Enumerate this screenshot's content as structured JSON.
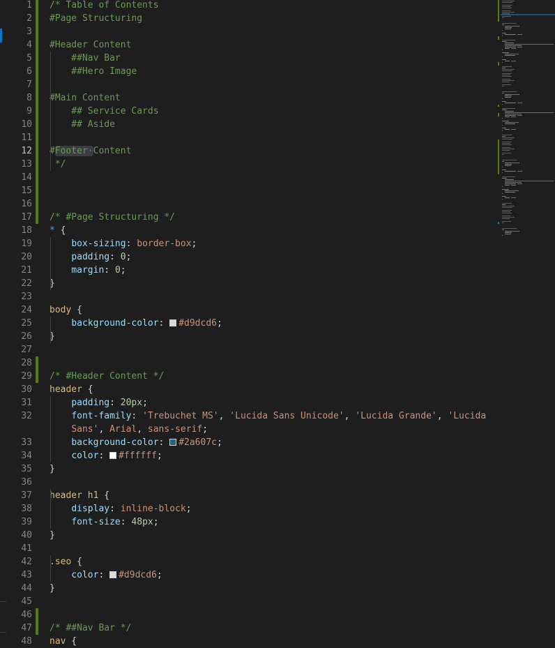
{
  "editor": {
    "active_line": 12,
    "lines": [
      {
        "n": "1",
        "tokens": [
          [
            "c-comment",
            "/* Table of Contents"
          ]
        ],
        "diff": true
      },
      {
        "n": "2",
        "tokens": [
          [
            "c-comment",
            "#Page Structuring"
          ]
        ],
        "diff": true
      },
      {
        "n": "3",
        "tokens": [],
        "diff": true
      },
      {
        "n": "4",
        "tokens": [
          [
            "c-comment",
            "#Header Content"
          ]
        ],
        "diff": true
      },
      {
        "n": "5",
        "tokens": [
          [
            "c-comment",
            "    ##Nav Bar"
          ]
        ],
        "diff": true
      },
      {
        "n": "6",
        "tokens": [
          [
            "c-comment",
            "    ##Hero Image"
          ]
        ],
        "diff": true
      },
      {
        "n": "7",
        "tokens": [],
        "diff": true
      },
      {
        "n": "8",
        "tokens": [
          [
            "c-comment",
            "#Main Content"
          ]
        ],
        "diff": true
      },
      {
        "n": "9",
        "tokens": [
          [
            "c-comment",
            "    ## Service Cards"
          ]
        ],
        "diff": true
      },
      {
        "n": "10",
        "tokens": [
          [
            "c-comment",
            "    ## Aside"
          ]
        ],
        "diff": true
      },
      {
        "n": "11",
        "tokens": [],
        "diff": true
      },
      {
        "n": "12",
        "tokens": [
          [
            "c-comment",
            "#"
          ],
          [
            "c-comment wordhl",
            "Footer·"
          ],
          [
            "c-comment",
            "Content"
          ]
        ],
        "diff": true
      },
      {
        "n": "13",
        "tokens": [
          [
            "c-comment",
            " */"
          ]
        ],
        "diff": true
      },
      {
        "n": "14",
        "tokens": [],
        "diff": true
      },
      {
        "n": "15",
        "tokens": [],
        "diff": true
      },
      {
        "n": "16",
        "tokens": [],
        "diff": true
      },
      {
        "n": "17",
        "tokens": [
          [
            "c-comment",
            "/* #Page Structuring */"
          ]
        ],
        "diff": true
      },
      {
        "n": "18",
        "tokens": [
          [
            "c-star",
            "*"
          ],
          [
            "c-punc",
            " {"
          ]
        ]
      },
      {
        "n": "19",
        "tokens": [
          [
            "c-punc",
            "    "
          ],
          [
            "c-prop",
            "box-sizing"
          ],
          [
            "c-punc",
            ": "
          ],
          [
            "c-val",
            "border-box"
          ],
          [
            "c-punc",
            ";"
          ]
        ]
      },
      {
        "n": "20",
        "tokens": [
          [
            "c-punc",
            "    "
          ],
          [
            "c-prop",
            "padding"
          ],
          [
            "c-punc",
            ": "
          ],
          [
            "c-num",
            "0"
          ],
          [
            "c-punc",
            ";"
          ]
        ]
      },
      {
        "n": "21",
        "tokens": [
          [
            "c-punc",
            "    "
          ],
          [
            "c-prop",
            "margin"
          ],
          [
            "c-punc",
            ": "
          ],
          [
            "c-num",
            "0"
          ],
          [
            "c-punc",
            ";"
          ]
        ]
      },
      {
        "n": "22",
        "tokens": [
          [
            "c-punc",
            "}"
          ]
        ]
      },
      {
        "n": "23",
        "tokens": []
      },
      {
        "n": "24",
        "tokens": [
          [
            "c-sel",
            "body"
          ],
          [
            "c-punc",
            " {"
          ]
        ]
      },
      {
        "n": "25",
        "tokens": [
          [
            "c-punc",
            "    "
          ],
          [
            "c-prop",
            "background-color"
          ],
          [
            "c-punc",
            ": "
          ],
          [
            "swatch",
            "#d9dcd6"
          ],
          [
            "c-val",
            "#d9dcd6"
          ],
          [
            "c-punc",
            ";"
          ]
        ]
      },
      {
        "n": "26",
        "tokens": [
          [
            "c-punc",
            "}"
          ]
        ]
      },
      {
        "n": "27",
        "tokens": []
      },
      {
        "n": "28",
        "tokens": [],
        "diff": true
      },
      {
        "n": "29",
        "tokens": [
          [
            "c-comment",
            "/* #Header Content */"
          ]
        ],
        "diff": true
      },
      {
        "n": "30",
        "tokens": [
          [
            "c-sel",
            "header"
          ],
          [
            "c-punc",
            " {"
          ]
        ]
      },
      {
        "n": "31",
        "tokens": [
          [
            "c-punc",
            "    "
          ],
          [
            "c-prop",
            "padding"
          ],
          [
            "c-punc",
            ": "
          ],
          [
            "c-num",
            "20px"
          ],
          [
            "c-punc",
            ";"
          ]
        ]
      },
      {
        "n": "32",
        "tokens": [
          [
            "c-punc",
            "    "
          ],
          [
            "c-prop",
            "font-family"
          ],
          [
            "c-punc",
            ": "
          ],
          [
            "c-val",
            "'Trebuchet MS'"
          ],
          [
            "c-punc",
            ", "
          ],
          [
            "c-val",
            "'Lucida Sans Unicode'"
          ],
          [
            "c-punc",
            ", "
          ],
          [
            "c-val",
            "'Lucida Grande'"
          ],
          [
            "c-punc",
            ", "
          ],
          [
            "c-val",
            "'Lucida"
          ]
        ]
      },
      {
        "n": "",
        "tokens": [
          [
            "c-punc",
            "    "
          ],
          [
            "c-val",
            "Sans'"
          ],
          [
            "c-punc",
            ", "
          ],
          [
            "c-val",
            "Arial"
          ],
          [
            "c-punc",
            ", "
          ],
          [
            "c-val",
            "sans-serif"
          ],
          [
            "c-punc",
            ";"
          ]
        ]
      },
      {
        "n": "33",
        "tokens": [
          [
            "c-punc",
            "    "
          ],
          [
            "c-prop",
            "background-color"
          ],
          [
            "c-punc",
            ": "
          ],
          [
            "swatch",
            "#2a607c"
          ],
          [
            "c-val",
            "#2a607c"
          ],
          [
            "c-punc",
            ";"
          ]
        ]
      },
      {
        "n": "34",
        "tokens": [
          [
            "c-punc",
            "    "
          ],
          [
            "c-prop",
            "color"
          ],
          [
            "c-punc",
            ": "
          ],
          [
            "swatch",
            "#ffffff"
          ],
          [
            "c-val",
            "#ffffff"
          ],
          [
            "c-punc",
            ";"
          ]
        ]
      },
      {
        "n": "35",
        "tokens": [
          [
            "c-punc",
            "}"
          ]
        ]
      },
      {
        "n": "36",
        "tokens": []
      },
      {
        "n": "37",
        "tokens": [
          [
            "c-sel",
            "header h1"
          ],
          [
            "c-punc",
            " {"
          ]
        ]
      },
      {
        "n": "38",
        "tokens": [
          [
            "c-punc",
            "    "
          ],
          [
            "c-prop",
            "display"
          ],
          [
            "c-punc",
            ": "
          ],
          [
            "c-val",
            "inline-block"
          ],
          [
            "c-punc",
            ";"
          ]
        ]
      },
      {
        "n": "39",
        "tokens": [
          [
            "c-punc",
            "    "
          ],
          [
            "c-prop",
            "font-size"
          ],
          [
            "c-punc",
            ": "
          ],
          [
            "c-num",
            "48px"
          ],
          [
            "c-punc",
            ";"
          ]
        ]
      },
      {
        "n": "40",
        "tokens": [
          [
            "c-punc",
            "}"
          ]
        ]
      },
      {
        "n": "41",
        "tokens": []
      },
      {
        "n": "42",
        "tokens": [
          [
            "c-sel",
            ".seo"
          ],
          [
            "c-punc",
            " {"
          ]
        ]
      },
      {
        "n": "43",
        "tokens": [
          [
            "c-punc",
            "    "
          ],
          [
            "c-prop",
            "color"
          ],
          [
            "c-punc",
            ": "
          ],
          [
            "swatch",
            "#d9dcd6"
          ],
          [
            "c-val",
            "#d9dcd6"
          ],
          [
            "c-punc",
            ";"
          ]
        ]
      },
      {
        "n": "44",
        "tokens": [
          [
            "c-punc",
            "}"
          ]
        ]
      },
      {
        "n": "45",
        "tokens": []
      },
      {
        "n": "46",
        "tokens": [],
        "diff": true
      },
      {
        "n": "47",
        "tokens": [
          [
            "c-comment",
            "/* ##Nav Bar */"
          ]
        ],
        "diff": true
      },
      {
        "n": "48",
        "tokens": [
          [
            "c-sel",
            "nav"
          ],
          [
            "c-punc",
            " {"
          ]
        ]
      }
    ]
  },
  "colors": {
    "background": "#1e1e1e",
    "diff_added": "#587c0c",
    "accent": "#007acc"
  }
}
